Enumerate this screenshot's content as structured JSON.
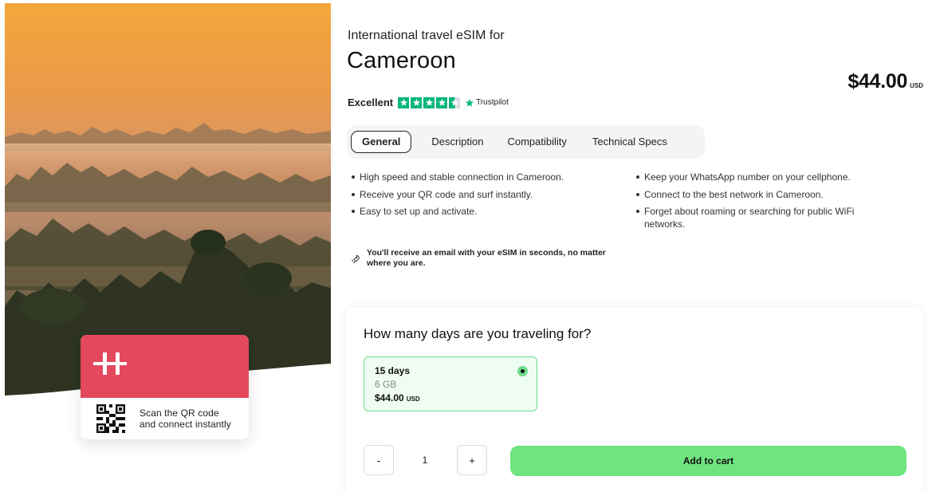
{
  "hero": {
    "image_name": "misty-forest-sunrise",
    "card": {
      "logo_name": "holafly-logo",
      "qr_name": "qr-code-icon",
      "text": "Scan the QR code and connect instantly",
      "accent": "#e4485c"
    }
  },
  "product": {
    "subtitle": "International travel eSIM for",
    "title": "Cameroon",
    "price": "$44.00",
    "currency": "USD"
  },
  "rating": {
    "label": "Excellent",
    "stars": 4.5,
    "provider": "Trustpilot",
    "color": "#00b67a"
  },
  "tabs": [
    {
      "label": "General",
      "active": true
    },
    {
      "label": "Description",
      "active": false
    },
    {
      "label": "Compatibility",
      "active": false
    },
    {
      "label": "Technical Specs",
      "active": false
    }
  ],
  "features_left": [
    "High speed and stable connection in Cameroon.",
    "Receive your QR code and surf instantly.",
    "Easy to set up and activate."
  ],
  "features_right": [
    "Keep your WhatsApp number on your cellphone.",
    "Connect to the best network in Cameroon.",
    "Forget about roaming or searching for public WiFi networks."
  ],
  "note": {
    "icon": "rocket-icon",
    "text": "You'll receive an email with your eSIM in seconds, no matter where you are."
  },
  "purchase": {
    "question": "How many days are you traveling for?",
    "plan": {
      "days": "15 days",
      "data": "6 GB",
      "price": "$44.00",
      "currency": "USD",
      "selected": true
    },
    "minus_label": "-",
    "quantity": "1",
    "plus_label": "+",
    "cart_label": "Add to cart",
    "accent": "#6fe47f"
  }
}
